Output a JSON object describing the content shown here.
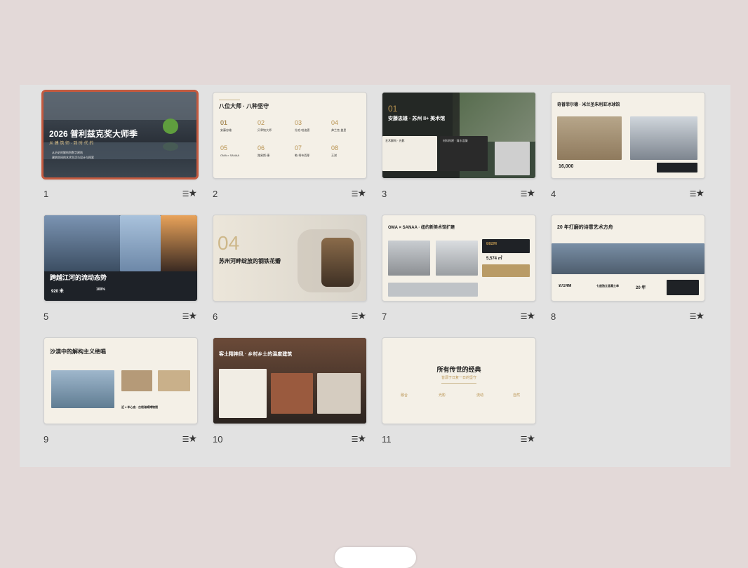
{
  "slides": [
    {
      "num": "1",
      "title": "2026 普利兹克奖大师季",
      "subtitle": "从 建 筑 师 · 到 时 代 的",
      "line1": "从历史的解构到数字建筑",
      "line2": "建筑空间的艺术生活与设计与探索"
    },
    {
      "num": "2",
      "title": "八位大师 · 八种坚守",
      "items": [
        {
          "n": "01",
          "name": "安藤忠雄"
        },
        {
          "n": "02",
          "name": "贝聿铭大师"
        },
        {
          "n": "03",
          "name": "扎哈·哈迪德"
        },
        {
          "n": "04",
          "name": "弗兰克·盖里"
        },
        {
          "n": "05",
          "name": "OMA × SANAA"
        },
        {
          "n": "06",
          "name": "路易斯·康"
        },
        {
          "n": "07",
          "name": "勒·柯布西耶"
        },
        {
          "n": "08",
          "name": "王澍"
        }
      ]
    },
    {
      "num": "3",
      "big": "01",
      "title": "安藤忠雄 · 苏州 II+ 美术馆",
      "panel_left": "艺术解构 · 光影",
      "panel_right": "材料构建 · 清水混凝"
    },
    {
      "num": "4",
      "title": "奇普菲尔德 · 米兰圣朱利亚冰球馆",
      "stat": "16,000"
    },
    {
      "num": "5",
      "title": "跨越江河的流动态势",
      "s1": "920 米",
      "s2": "100%"
    },
    {
      "num": "6",
      "big": "04",
      "title": "苏州河畔绽放的钢铁花瓣"
    },
    {
      "num": "7",
      "title": "OMA × SANAA · 纽约新美术馆扩建",
      "s1": "882M",
      "s2": "5,574 ㎡"
    },
    {
      "num": "8",
      "title": "20 年打磨的诗意艺术方舟",
      "s1": "¥724M",
      "s2": "七座独立混凝土单",
      "s3": "20 年"
    },
    {
      "num": "9",
      "title": "沙漠中的解构主义绝唱",
      "note": "近 4 年心血 · 古根海姆博物馆"
    },
    {
      "num": "10",
      "title": "客土精神风 · 乡村乡土的温度建筑"
    },
    {
      "num": "11",
      "title": "所有传世的经典",
      "subtitle": "皆源于日复一日的坚守",
      "cols": [
        "融合",
        "光影",
        "流动",
        "自然"
      ]
    }
  ],
  "star_glyph": "★",
  "menu_glyph": "☰"
}
